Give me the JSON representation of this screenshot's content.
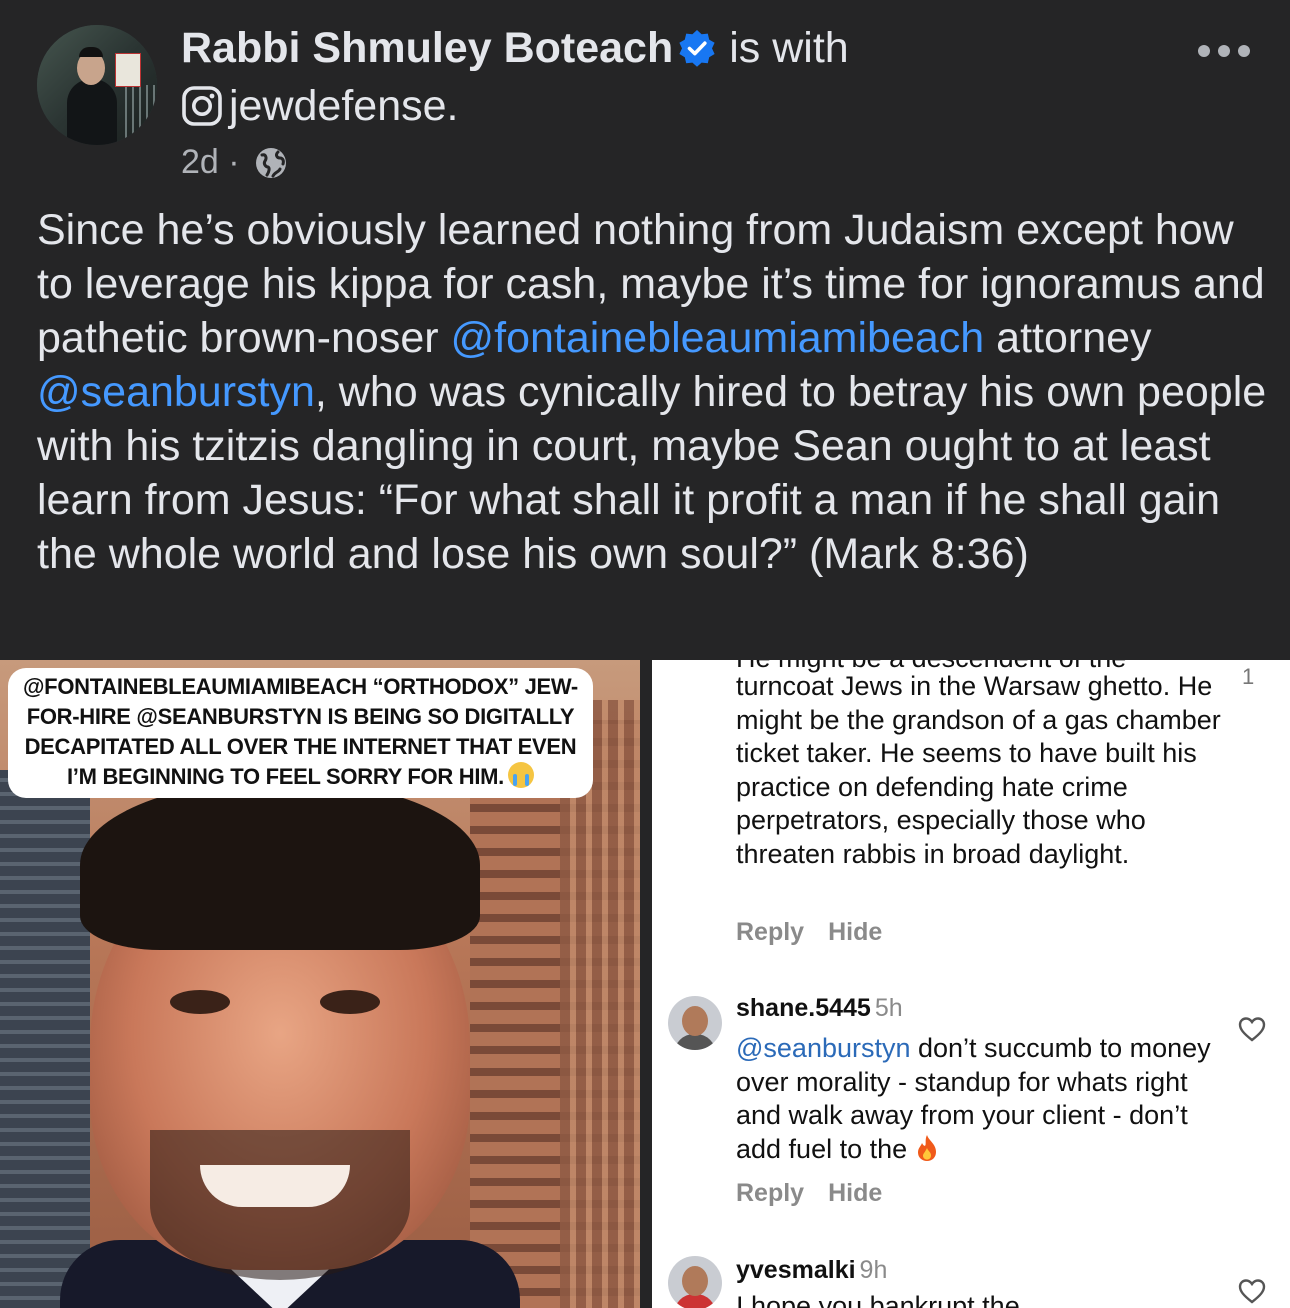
{
  "post": {
    "author": "Rabbi Shmuley Boteach",
    "with_text": "is with",
    "tagged": "jewdefense.",
    "time": "2d",
    "separator": "·",
    "text_1": "Since he’s obviously learned nothing from Judaism except how to leverage his kippa for cash, maybe it’s time for ignoramus and pathetic brown-noser ",
    "mention_1": "@fontainebleaumiamibeach",
    "text_2": " attorney ",
    "mention_2": "@seanburstyn",
    "text_3": ", who was cynically hired to betray his own people with his tzitzis dangling in court, maybe Sean ought to at least learn from Jesus: “For what shall it profit a man if he shall gain the whole world and lose his own soul?” (Mark 8:36)"
  },
  "image": {
    "caption": "@FONTAINEBLEAUMIAMIBEACH “ORTHODOX” JEW-FOR-HIRE @SEANBURSTYN IS BEING SO DIGITALLY DECAPITATED ALL OVER THE INTERNET THAT EVEN I’M BEGINNING TO FEEL SORRY FOR HIM."
  },
  "comments": {
    "first": {
      "cut_line": "He might be a descendent of the",
      "like_count": "1",
      "text": "turncoat Jews in the Warsaw ghetto. He might be the grandson of a gas chamber ticket taker. He seems to have built his practice on defending hate crime perpetrators, especially those who threaten rabbis in broad daylight.",
      "reply": "Reply",
      "hide": "Hide"
    },
    "second": {
      "username": "shane.5445",
      "time": "5h",
      "mention": "@seanburstyn",
      "text": " don’t succumb to money over morality - standup for whats right and walk away from your client - don’t add fuel to the ",
      "reply": "Reply",
      "hide": "Hide"
    },
    "third": {
      "username": "yvesmalki",
      "time": "9h",
      "cut_line": "I hope you bankrupt the"
    }
  },
  "icons": {
    "verified_color": "#1877f2",
    "mention_color": "#4599ff",
    "ig_mention_color": "#2b6ab8"
  }
}
